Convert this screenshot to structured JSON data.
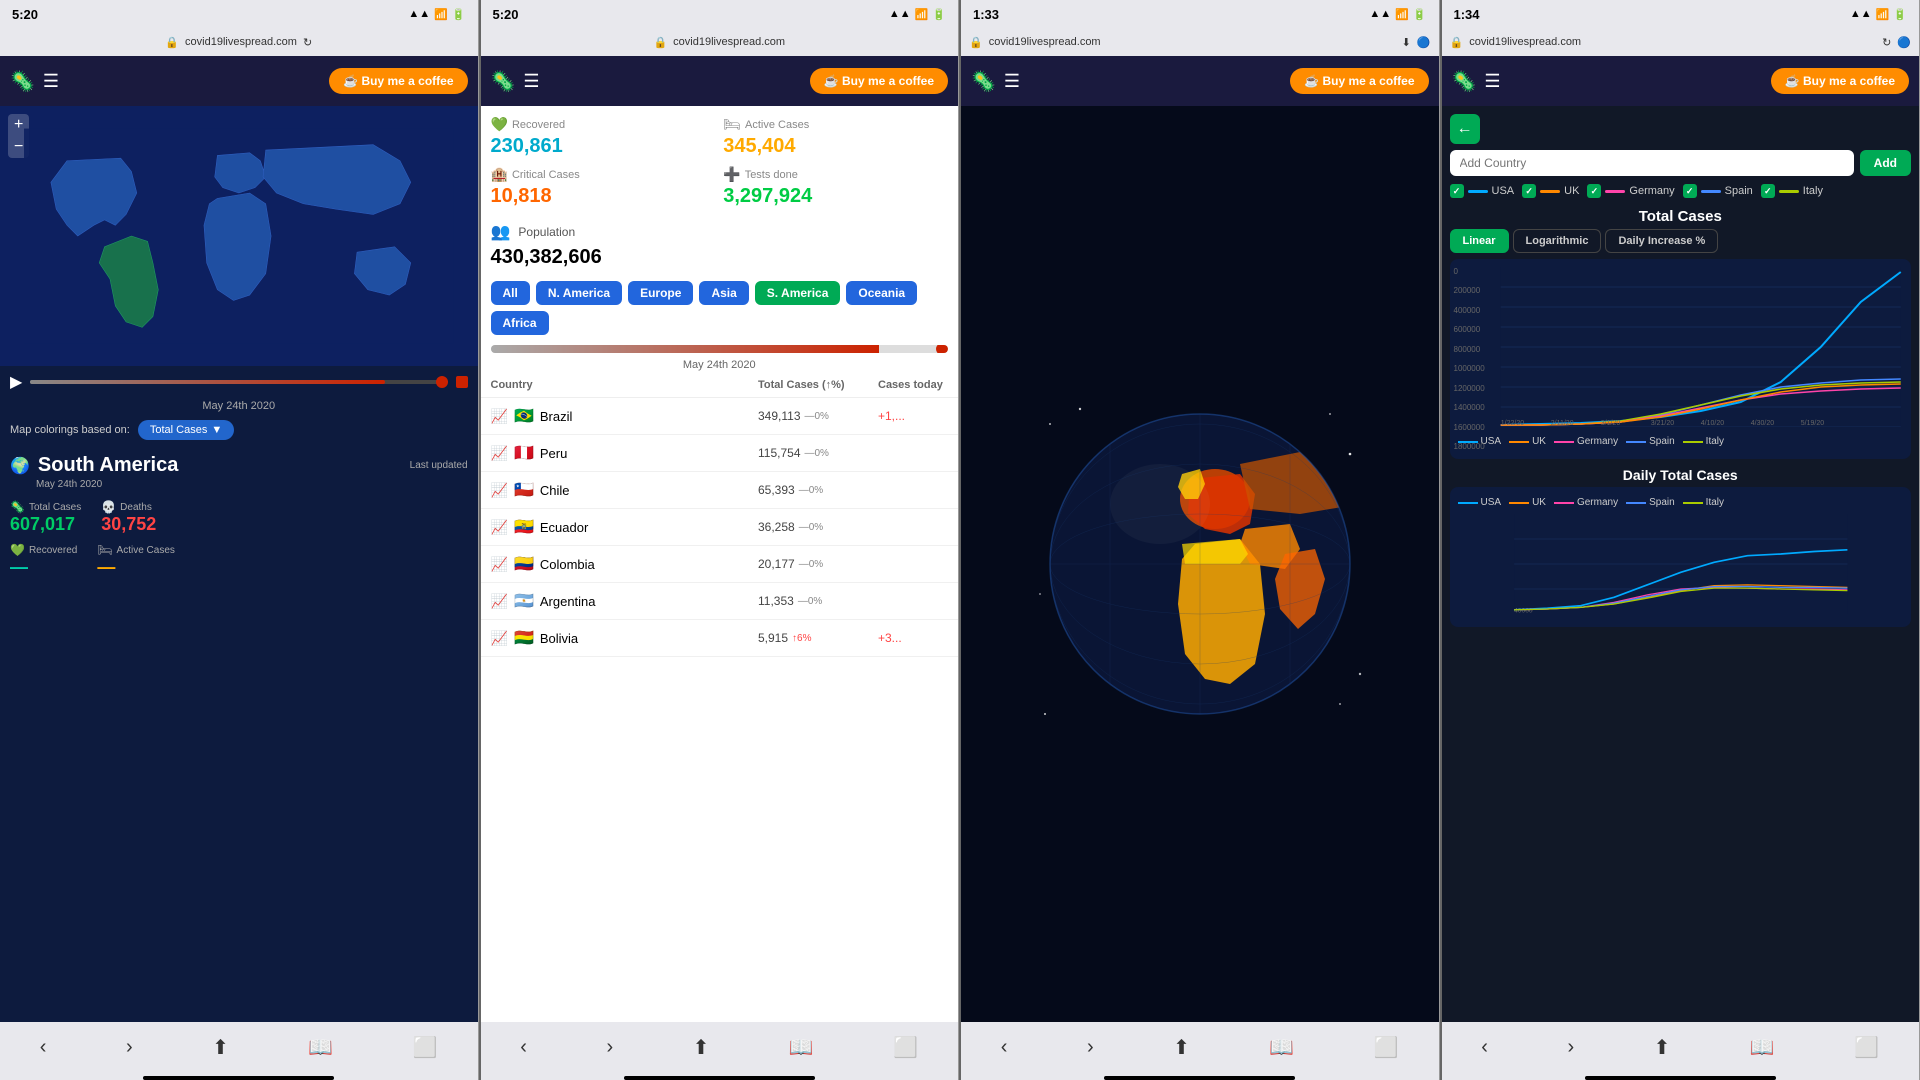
{
  "phones": [
    {
      "id": "phone1",
      "statusBar": {
        "time": "5:20",
        "signal": "▲",
        "wifi": "wifi",
        "battery": "battery"
      },
      "addressBar": {
        "url": "covid19livespread.com"
      },
      "header": {
        "coffeeBtn": "☕ Buy me a coffee"
      },
      "map": {
        "dateLabel": "May 24th 2020",
        "mapColoringLabel": "Map colorings based on:",
        "dropdownLabel": "Total Cases"
      },
      "region": {
        "icon": "🌍",
        "name": "South America",
        "lastUpdated": "Last updated",
        "date": "May 24th 2020"
      },
      "stats": [
        {
          "label": "Total Cases",
          "icon": "🦠",
          "value": "607,017",
          "color": "green"
        },
        {
          "label": "Deaths",
          "icon": "💀",
          "value": "30,752",
          "color": "red"
        }
      ]
    },
    {
      "id": "phone2",
      "statusBar": {
        "time": "5:20"
      },
      "addressBar": {
        "url": "covid19livespread.com"
      },
      "header": {
        "coffeeBtn": "☕ Buy me a coffee"
      },
      "stats": [
        {
          "label": "Recovered",
          "icon": "💚",
          "value": "230,861",
          "color": "teal"
        },
        {
          "label": "Active Cases",
          "icon": "🛏",
          "value": "345,404",
          "color": "yellow"
        },
        {
          "label": "Critical Cases",
          "icon": "🏨",
          "value": "10,818",
          "color": "orange"
        },
        {
          "label": "Tests done",
          "icon": "➕",
          "value": "3,297,924",
          "color": "green"
        }
      ],
      "population": {
        "label": "Population",
        "value": "430,382,606"
      },
      "tabs": [
        {
          "label": "All",
          "color": "blue"
        },
        {
          "label": "N. America",
          "color": "blue"
        },
        {
          "label": "Europe",
          "color": "blue"
        },
        {
          "label": "Asia",
          "color": "blue"
        },
        {
          "label": "S. America",
          "color": "green"
        },
        {
          "label": "Oceania",
          "color": "blue"
        },
        {
          "label": "Africa",
          "color": "blue"
        }
      ],
      "dateLabel": "May 24th 2020",
      "tableHeaders": [
        "Country",
        "Total Cases (↑%)",
        "Cases today"
      ],
      "countries": [
        {
          "flag": "🇧🇷",
          "name": "Brazil",
          "cases": "349,113",
          "pct": "—0%",
          "today": "+1,..."
        },
        {
          "flag": "🇵🇪",
          "name": "Peru",
          "cases": "115,754",
          "pct": "—0%",
          "today": ""
        },
        {
          "flag": "🇨🇱",
          "name": "Chile",
          "cases": "65,393",
          "pct": "—0%",
          "today": ""
        },
        {
          "flag": "🇪🇨",
          "name": "Ecuador",
          "cases": "36,258",
          "pct": "—0%",
          "today": ""
        },
        {
          "flag": "🇨🇴",
          "name": "Colombia",
          "cases": "20,177",
          "pct": "—0%",
          "today": ""
        },
        {
          "flag": "🇦🇷",
          "name": "Argentina",
          "cases": "11,353",
          "pct": "—0%",
          "today": ""
        },
        {
          "flag": "🇧🇴",
          "name": "Bolivia",
          "cases": "5,915",
          "pct": "↑6%",
          "today": "+3..."
        }
      ]
    },
    {
      "id": "phone3",
      "statusBar": {
        "time": "1:33"
      },
      "addressBar": {
        "url": "covid19livespread.com"
      },
      "header": {
        "coffeeBtn": "☕ Buy me a coffee"
      }
    },
    {
      "id": "phone4",
      "statusBar": {
        "time": "1:34"
      },
      "addressBar": {
        "url": "covid19livespread.com"
      },
      "header": {
        "coffeeBtn": "☕ Buy me a coffee"
      },
      "addCountry": {
        "placeholder": "Add Country",
        "btnLabel": "Add"
      },
      "legend": [
        {
          "name": "USA",
          "color": "#00aaff",
          "checked": true
        },
        {
          "name": "UK",
          "color": "#ff8800",
          "checked": true
        },
        {
          "name": "Germany",
          "color": "#ff44aa",
          "checked": true
        },
        {
          "name": "Spain",
          "color": "#00aaff",
          "checked": true
        },
        {
          "name": "Italy",
          "color": "#aacc00",
          "checked": true
        }
      ],
      "totalCasesChart": {
        "title": "Total Cases",
        "tabs": [
          "Linear",
          "Logarithmic",
          "Daily Increase %"
        ],
        "activeTab": "Linear"
      },
      "dailyChart": {
        "title": "Daily Total Cases",
        "legend": [
          {
            "name": "USA",
            "color": "#00aaff"
          },
          {
            "name": "UK",
            "color": "#ff8800"
          },
          {
            "name": "Germany",
            "color": "#ff44aa"
          },
          {
            "name": "Spain",
            "color": "#00aaff"
          },
          {
            "name": "Italy",
            "color": "#aacc00"
          }
        ]
      },
      "yAxisLabels": [
        "0",
        "200000",
        "400000",
        "600000",
        "800000",
        "1000000",
        "1200000",
        "1400000",
        "1600000",
        "1800000"
      ]
    }
  ]
}
